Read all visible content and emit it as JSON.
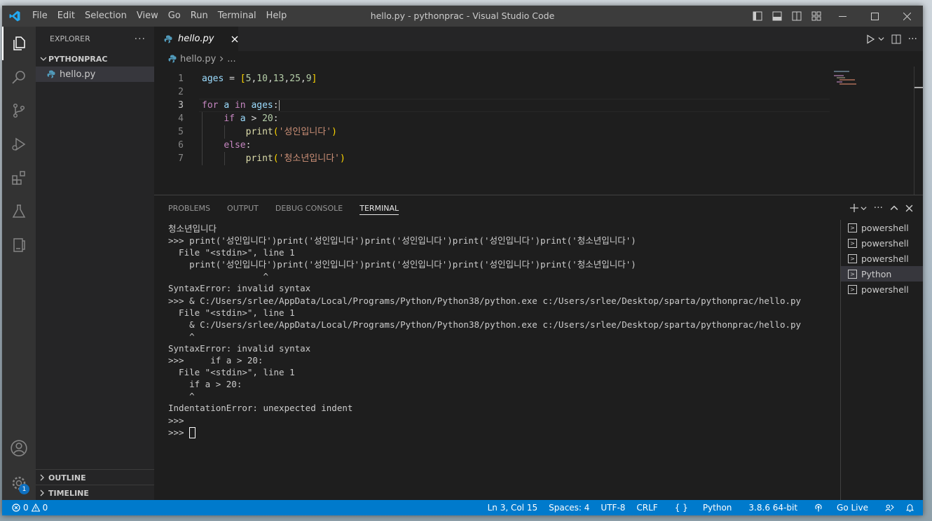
{
  "window": {
    "title": "hello.py - pythonprac - Visual Studio Code",
    "menu": [
      "File",
      "Edit",
      "Selection",
      "View",
      "Go",
      "Run",
      "Terminal",
      "Help"
    ]
  },
  "sidebar": {
    "header": "EXPLORER",
    "folder": "PYTHONPRAC",
    "files": [
      "hello.py"
    ],
    "outline": "OUTLINE",
    "timeline": "TIMELINE"
  },
  "activity": {
    "settings_badge": "1"
  },
  "editor": {
    "tab": "hello.py",
    "breadcrumb_file": "hello.py",
    "breadcrumb_more": "...",
    "line_numbers": [
      "1",
      "2",
      "3",
      "4",
      "5",
      "6",
      "7"
    ],
    "current_line": 3
  },
  "panel": {
    "tabs": [
      "PROBLEMS",
      "OUTPUT",
      "DEBUG CONSOLE",
      "TERMINAL"
    ],
    "active_tab": "TERMINAL",
    "terminal_lines": [
      "청소년입니다",
      ">>> print('성인입니다')print('성인입니다')print('성인입니다')print('성인입니다')print('청소년입니다')",
      "  File \"<stdin>\", line 1",
      "    print('성인입니다')print('성인입니다')print('성인입니다')print('성인입니다')print('청소년입니다')",
      "                  ^",
      "SyntaxError: invalid syntax",
      ">>> & C:/Users/srlee/AppData/Local/Programs/Python/Python38/python.exe c:/Users/srlee/Desktop/sparta/pythonprac/hello.py",
      "  File \"<stdin>\", line 1",
      "    & C:/Users/srlee/AppData/Local/Programs/Python/Python38/python.exe c:/Users/srlee/Desktop/sparta/pythonprac/hello.py",
      "    ^",
      "SyntaxError: invalid syntax",
      ">>>     if a > 20:",
      "  File \"<stdin>\", line 1",
      "    if a > 20:",
      "    ^",
      "IndentationError: unexpected indent",
      ">>>"
    ],
    "prompt": ">>> ",
    "terminals": [
      {
        "name": "powershell",
        "selected": false
      },
      {
        "name": "powershell",
        "selected": false
      },
      {
        "name": "powershell",
        "selected": false
      },
      {
        "name": "Python",
        "selected": true
      },
      {
        "name": "powershell",
        "selected": false
      }
    ]
  },
  "status": {
    "errors": "0",
    "warnings": "0",
    "position": "Ln 3, Col 15",
    "spaces": "Spaces: 4",
    "encoding": "UTF-8",
    "eol": "CRLF",
    "language": "Python",
    "interpreter": "3.8.6 64-bit",
    "live": "Go Live"
  },
  "colors": {
    "accent": "#007acc",
    "background": "#1e1e1e",
    "sidebar": "#252526",
    "activity": "#333333"
  }
}
